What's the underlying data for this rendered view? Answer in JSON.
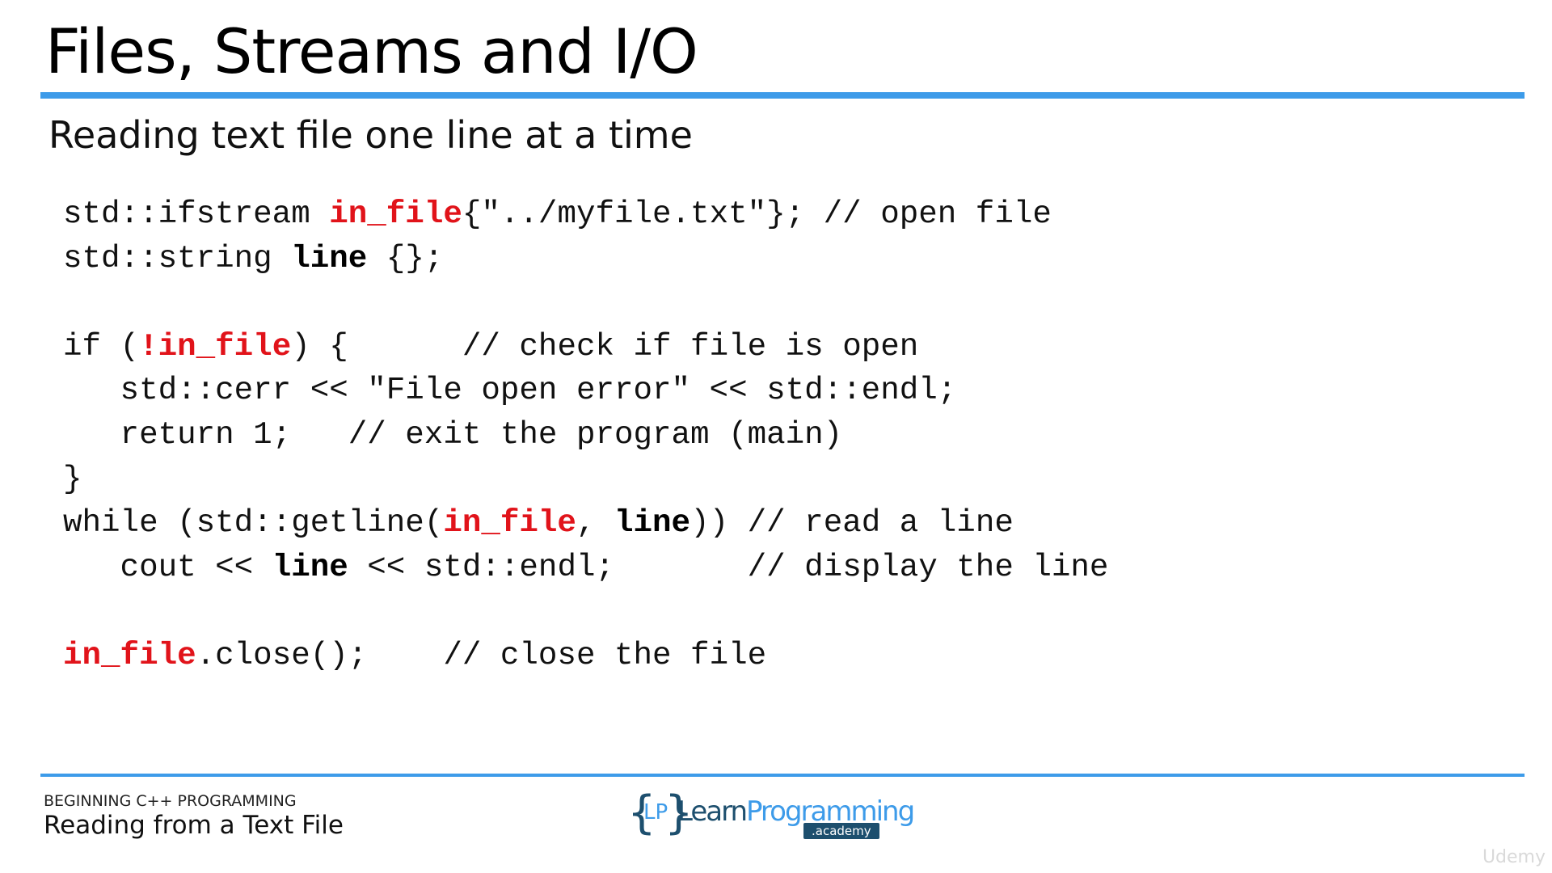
{
  "slide": {
    "title": "Files, Streams and I/O",
    "subtitle": "Reading text file one line at a time"
  },
  "code": {
    "lines": [
      [
        {
          "t": "std::ifstream ",
          "s": ""
        },
        {
          "t": "in_file",
          "s": "red"
        },
        {
          "t": "{\"../myfile.txt\"}; // open file",
          "s": ""
        }
      ],
      [
        {
          "t": "std::string ",
          "s": ""
        },
        {
          "t": "line",
          "s": "bold"
        },
        {
          "t": " {};",
          "s": ""
        }
      ],
      [],
      [
        {
          "t": "if (",
          "s": ""
        },
        {
          "t": "!in_file",
          "s": "red"
        },
        {
          "t": ") {      // check if file is open",
          "s": ""
        }
      ],
      [
        {
          "t": "   std::cerr << \"File open error\" << std::endl;",
          "s": ""
        }
      ],
      [
        {
          "t": "   return 1;   // exit the program (main)",
          "s": ""
        }
      ],
      [
        {
          "t": "}",
          "s": ""
        }
      ],
      [
        {
          "t": "while (std::getline(",
          "s": ""
        },
        {
          "t": "in_file",
          "s": "red"
        },
        {
          "t": ", ",
          "s": ""
        },
        {
          "t": "line",
          "s": "bold"
        },
        {
          "t": ")) // read a line",
          "s": ""
        }
      ],
      [
        {
          "t": "   cout << ",
          "s": ""
        },
        {
          "t": "line",
          "s": "bold"
        },
        {
          "t": " << std::endl;       // display the line",
          "s": ""
        }
      ],
      [],
      [
        {
          "t": "in_file",
          "s": "red"
        },
        {
          "t": ".close();    // close the file",
          "s": ""
        }
      ]
    ]
  },
  "footer": {
    "course": "BEGINNING C++ PROGRAMMING",
    "lesson": "Reading from a Text File"
  },
  "logo": {
    "brace_open": "{",
    "initials": "LP",
    "brace_close": "}",
    "word_learn": "Learn",
    "word_programming": "Programming",
    "academy": ".academy"
  },
  "watermark": "Udemy",
  "colors": {
    "accent": "#3d9be9",
    "highlight_red": "#e1131a",
    "logo_dark": "#1d4f6e"
  }
}
